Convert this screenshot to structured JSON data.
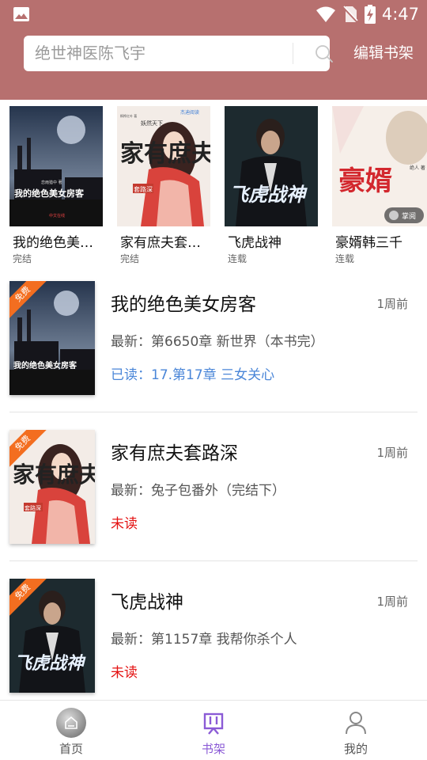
{
  "status_bar": {
    "time": "4:47",
    "icons": [
      "gallery-icon",
      "wifi-icon",
      "no-sim-icon",
      "battery-charging-icon"
    ]
  },
  "header": {
    "search_placeholder": "绝世神医陈飞宇",
    "edit_label": "编辑书架",
    "search_icon": "search-icon",
    "background_color": "#b7706f"
  },
  "recommendations": [
    {
      "title": "我的绝色美女房客",
      "status": "完结"
    },
    {
      "title": "家有庶夫套路深",
      "status": "完结"
    },
    {
      "title": "飞虎战神",
      "status": "连载"
    },
    {
      "title": "豪婿韩三千",
      "status": "连载"
    }
  ],
  "covers": {
    "beauty": {
      "title_art": "我的绝色美女房客",
      "author_art": "恋雨猎中 著",
      "publisher": "中文在线"
    },
    "husband": {
      "top_art": "妖然天下",
      "logo": "杰迪阅读",
      "title_art": "家有庶夫",
      "subtitle_art": "套路深",
      "author_art": "枫桦红叶 著"
    },
    "tiger": {
      "title_art": "飞虎战神"
    },
    "rich": {
      "title_art": "豪婿",
      "author_art": "绝人 著",
      "watermark": "掌阅"
    }
  },
  "shelf": [
    {
      "title": "我的绝色美女房客",
      "time": "1周前",
      "latest": "最新：第6650章 新世界（本书完）",
      "read": "已读：17.第17章 三女关心",
      "read_state": "read",
      "badge": "免费"
    },
    {
      "title": "家有庶夫套路深",
      "time": "1周前",
      "latest": "最新：兔子包番外（完结下）",
      "read": "未读",
      "read_state": "unread",
      "badge": "免费"
    },
    {
      "title": "飞虎战神",
      "time": "1周前",
      "latest": "最新：第1157章 我帮你杀个人",
      "read": "未读",
      "read_state": "unread",
      "badge": "免费"
    }
  ],
  "bottom_nav": [
    {
      "label": "首页",
      "icon": "home-icon",
      "active": false
    },
    {
      "label": "书架",
      "icon": "bookshelf-icon",
      "active": true
    },
    {
      "label": "我的",
      "icon": "profile-icon",
      "active": false
    }
  ],
  "colors": {
    "accent": "#8b5bd6",
    "read_blue": "#4a86d8",
    "unread_red": "#e41212",
    "badge_orange": "#f36e20"
  }
}
